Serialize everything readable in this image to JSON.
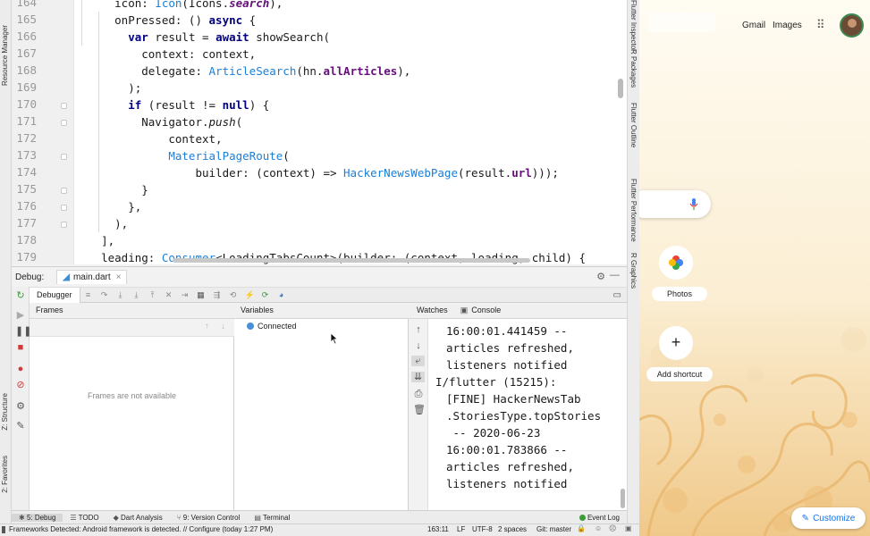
{
  "editor": {
    "line_numbers": [
      "164",
      "165",
      "166",
      "167",
      "168",
      "169",
      "170",
      "171",
      "172",
      "173",
      "174",
      "175",
      "176",
      "177",
      "178",
      "179"
    ],
    "lines": [
      [
        {
          "t": "      icon: "
        },
        {
          "t": "Icon",
          "c": "ty"
        },
        {
          "t": "(Icons."
        },
        {
          "t": "search",
          "c": "pu it"
        },
        {
          "t": "),"
        }
      ],
      [
        {
          "t": "      onPressed: () "
        },
        {
          "t": "async",
          "c": "kw"
        },
        {
          "t": " {"
        }
      ],
      [
        {
          "t": "        "
        },
        {
          "t": "var",
          "c": "kw"
        },
        {
          "t": " result = "
        },
        {
          "t": "await",
          "c": "kw"
        },
        {
          "t": " showSearch("
        }
      ],
      [
        {
          "t": "          context: context,"
        }
      ],
      [
        {
          "t": "          delegate: "
        },
        {
          "t": "ArticleSearch",
          "c": "ty"
        },
        {
          "t": "(hn."
        },
        {
          "t": "allArticles",
          "c": "pu"
        },
        {
          "t": "),"
        }
      ],
      [
        {
          "t": "        );"
        }
      ],
      [
        {
          "t": "        "
        },
        {
          "t": "if",
          "c": "kw"
        },
        {
          "t": " (result != "
        },
        {
          "t": "null",
          "c": "kw"
        },
        {
          "t": ") {"
        }
      ],
      [
        {
          "t": "          Navigator."
        },
        {
          "t": "push",
          "c": "it"
        },
        {
          "t": "("
        }
      ],
      [
        {
          "t": "              context,"
        }
      ],
      [
        {
          "t": "              "
        },
        {
          "t": "MaterialPageRoute",
          "c": "ty"
        },
        {
          "t": "("
        }
      ],
      [
        {
          "t": "                  builder: (context) => "
        },
        {
          "t": "HackerNewsWebPage",
          "c": "ty"
        },
        {
          "t": "(result."
        },
        {
          "t": "url",
          "c": "pu"
        },
        {
          "t": ")));"
        }
      ],
      [
        {
          "t": "          }"
        }
      ],
      [
        {
          "t": "        },"
        }
      ],
      [
        {
          "t": "      ),"
        }
      ],
      [
        {
          "t": "    ],"
        }
      ],
      [
        {
          "t": "    leading: "
        },
        {
          "t": "Consumer",
          "c": "ty"
        },
        {
          "t": "<LoadingTabsCount>(builder: (context, loading, child) {"
        }
      ]
    ]
  },
  "left_strip": {
    "resource_manager": "Resource Manager",
    "structure": "Z: Structure",
    "favorites": "2: Favorites"
  },
  "right_strip": {
    "inspector": "Flutter Inspector",
    "packages": "R Packages",
    "outline": "Flutter Outline",
    "performance": "Flutter Performance",
    "graphics": "R Graphics"
  },
  "debug": {
    "label": "Debug:",
    "tab": "main.dart",
    "debugger_tab": "Debugger",
    "frames_title": "Frames",
    "frames_empty": "Frames are not available",
    "variables_title": "Variables",
    "connected": "Connected",
    "watches_title": "Watches",
    "console_title": "Console",
    "console_lines": [
      "16:00:01.441459 --",
      "articles refreshed,",
      "listeners notified",
      "I/flutter (15215):",
      "[FINE] HackerNewsTab",
      ".StoriesType.topStories",
      " -- 2020-06-23",
      "16:00:01.783866 --",
      "articles refreshed,",
      "listeners notified"
    ]
  },
  "bottom_tabs": [
    "5: Debug",
    "TODO",
    "Dart Analysis",
    "9: Version Control",
    "Terminal"
  ],
  "event_log": "Event Log",
  "status": {
    "message": "Frameworks Detected: Android framework is detected. // Configure (today 1:27 PM)",
    "position": "163:11",
    "line_sep": "LF",
    "encoding": "UTF-8",
    "indent": "2 spaces",
    "git": "Git: master"
  },
  "browser": {
    "gmail": "Gmail",
    "images": "Images",
    "shortcuts": [
      {
        "label": "Photos"
      },
      {
        "label": "Add shortcut"
      }
    ],
    "customize": "Customize"
  },
  "colors": {
    "keyword": "#000080",
    "type": "#1a7fd8",
    "property": "#660e7a",
    "accent_blue": "#1a73e8"
  }
}
